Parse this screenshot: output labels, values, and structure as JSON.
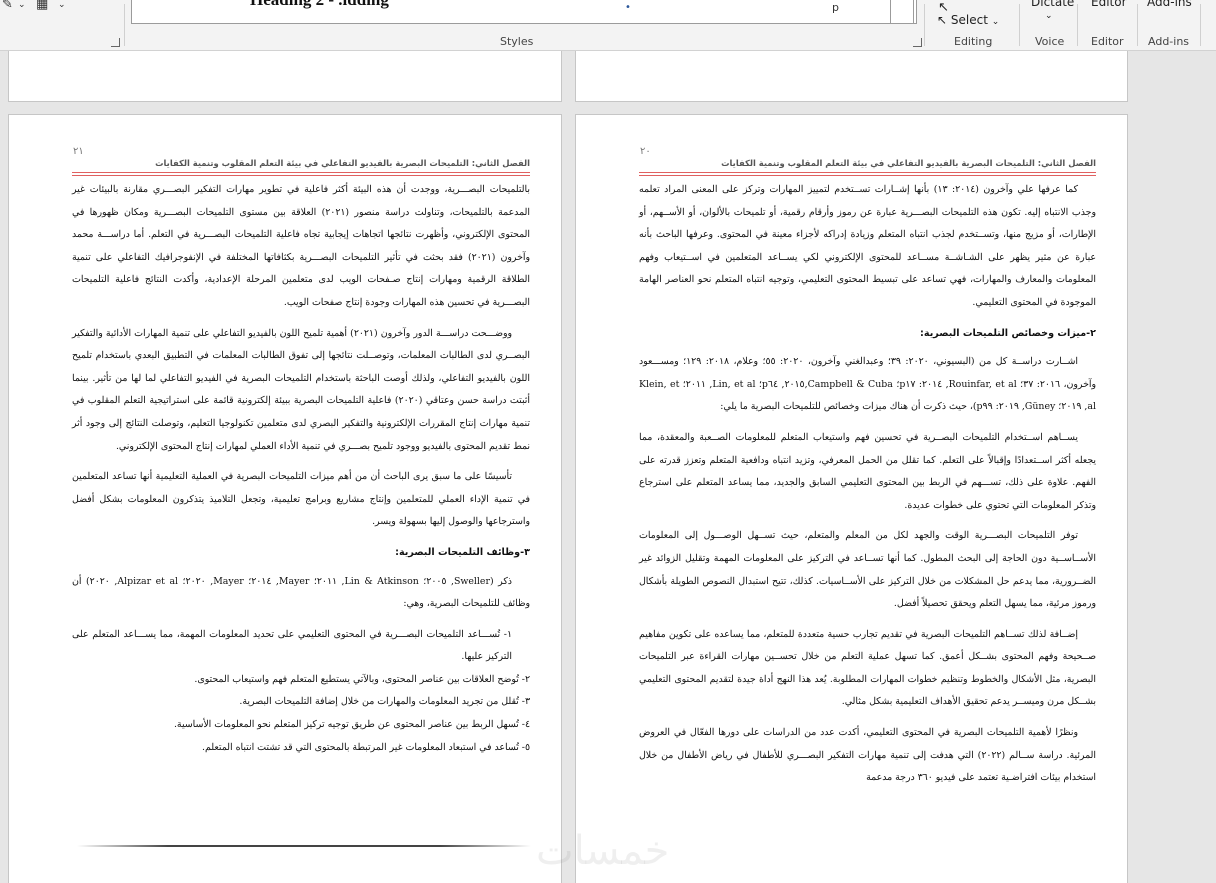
{
  "ribbon": {
    "groups": {
      "styles": "Styles",
      "editing": "Editing",
      "voice": "Voice",
      "editor": "Editor",
      "addins": "Add-ins"
    },
    "select_label": "Select",
    "dictate_label": "Dictate",
    "editor_btn": "Editor",
    "addins_btn": "Add-ins",
    "styles_preview": "Heading 2 - .idding",
    "styles_preview_p": "p"
  },
  "pages": {
    "left": {
      "number": "٢١",
      "running_head": "الفصل الثاني: التلميحات البصرية بالفيديو التفاعلي في بيئة التعلم المقلوب وتنمية الكفايات",
      "paragraphs": [
        "بالتلميحات البصـــرية، ووجدت أن هذه البيئة أكثر فاعلية في تطوير مهارات التفكير البصـــري مقارنة بالبيئات غير المدعمة بالتلميحات، وتناولت دراسة منصور (٢٠٢١) العلاقة بين مستوى التلميحات البصـــرية ومكان ظهورها في المحتوى الإلكتروني، وأظهرت نتائجها اتجاهات إيجابية تجاه فاعلية التلميحات البصـــرية في التعلم. أما دراســـة محمد وآخرون (٢٠٢١) فقد بحثت في تأثير التلميحات البصـــرية بكثافاتها المختلفة في الإنفوجرافيك التفاعلي على تنمية الطلاقة الرقمية ومهارات إنتاج صـفحات الويب لدى متعلمين المرحلة الإعدادية، وأكدت النتائج فاعلية التلميحات البصـــرية في تحسين هذه المهارات وجودة إنتاج صفحات الويب.",
        "ووضـــحت دراســـة الدور وآخرون (٢٠٢١) أهمية تلميح اللون بالفيديو التفاعلي على تنمية المهارات الأدائية والتفكير البصــري لدى الطالبات المعلمات، وتوصــلت نتائجها إلى تفوق الطالبات المعلمات في التطبيق البعدي باستخدام تلميح اللون بالفيديو التفاعلي، ولذلك أوصت الباحثة باستخدام التلميحات البصرية في الفيديو التفاعلي لما لها من تأثير. بينما أثبتت دراسة حسن وعتاقي (٢٠٢٠) فاعلية التلميحات البصرية ببيئة إلكترونية قائمة على استراتيجية التعلم المقلوب في تنمية مهارات إنتاج المقررات الإلكترونية والتفكير البصري لدى متعلمين تكنولوجيا التعليم، وتوصلت النتائج إلى وجود أثر نمط تقديم المحتوى بالفيديو ووجود تلميح بصـــري في تنمية الأداء العملي لمهارات إنتاج المحتوى الإلكتروني.",
        "تأسيسًا على ما سبق يرى الباحث أن من أهم ميزات التلميحات البصرية في العملية التعليمية أنها تساعد المتعلمين في تنمية الإداء العملي للمتعلمين وإنتاج مشاريع وبرامج تعليمية، وتجعل التلاميذ يتذكرون المعلومات بشكل أفضل واسترجاعها والوصول إليها بسهولة ويسر."
      ],
      "heading": "٣-وظائف التلميحات البصرية:",
      "intro": "ذكر (Sweller, ٢٠٠٥؛ Lin & Atkinson, ٢٠١١؛ Mayer, ٢٠١٤؛ Mayer, ٢٠٢٠؛ Alpizar et al, ٢٠٢٠) أن وظائف للتلميحات البصرية، وهي:",
      "list": [
        "١- تُســـاعد التلميحات البصـــرية في المحتوى التعليمي على تحديد المعلومات المهمة، مما يســـاعد المتعلم على التركيز عليها.",
        "٢- تُوضح العلاقات بين عناصر المحتوى، وبالآتي يستطيع المتعلم فهم واستيعاب المحتوى.",
        "٣- تُقلل من تجريد المعلومات والمهارات من خلال إضافة التلميحات البصرية.",
        "٤- تُسهل الربط بين عناصر المحتوى عن طريق توجيه تركيز المتعلم نحو المعلومات الأساسية.",
        "٥- تُساعد في استبعاد المعلومات غير المرتبطة بالمحتوى التي قد تشتت انتباه المتعلم."
      ]
    },
    "right": {
      "number": "٢٠",
      "running_head": "الفصل الثاني: التلميحات البصرية بالفيديو التفاعلي في بيئة التعلم المقلوب وتنمية الكفايات",
      "p1": "كما عرفها علي وآخرون (٢٠١٤: ١٣) بأنها إشــارات تســتخدم لتمييز المهارات وتركز على المعنى المراد تعلمه وجذب الانتباه إليه. تكون هذه التلميحات البصـــرية عبارة عن رموز وأرقام رقمية، أو تلميحات بالألوان، أو الأســهم، أو الإطارات، أو مزيج منها، وتســتخدم لجذب انتباه المتعلم وزيادة إدراكه لأجزاء معينة في المحتوى. وعرفها الباحث بأنه عبارة عن مثير يظهر على الشـاشــة مســاعد للمحتوى الإلكتروني لكي يســاعد المتعلمين في اســتيعاب وفهم المعلومات والمعارف والمهارات، فهي تساعد على تبسيط المحتوى التعليمي، وتوجيه انتباه المتعلم نحو العناصر الهامة الموجودة في المحتوى التعليمي.",
      "heading": "٢-ميزات وخصائص التلميحات البصرية:",
      "p2": "اشــارت دراســة كل من (البسيوني، ٢٠٢٠: ٣٩؛ وعبدالغني وآخرون، ٢٠٢٠: ٥٥؛ وعلام، ٢٠١٨: ١٢٩؛ ومســـعود وآخرون، ٢٠١٦: ٣٧؛ Rouinfar, et al, ٢٠١٤: p١٧؛ Campbell & Cuba,٢٠١٥, p٦٤؛ Lin, et al, ٢٠١١؛ Klein, et al, ٢٠١٩؛ Güney, ٢٠١٩: p٩٩)، حيث ذكرت أن هناك ميزات وخصائص للتلميحات البصرية ما يلي:",
      "p3": "يســاهم اســتخدام التلميحات البصــرية في تحسين فهم واستيعاب المتعلم للمعلومات الصــعبة والمعقدة، مما يجعله أكثر اســتعدادًا وإقبالاً على التعلم. كما تقلل من الحمل المعرفي، وتزيد انتباه ودافعية المتعلم وتعزز قدرته على الفهم. علاوة على ذلك، تســـهم في الربط بين المحتوى التعليمي السابق والجديد، مما يساعد المتعلم على استرجاع وتذكر المعلومات التي تحتوي على خطوات عديدة.",
      "p4": "توفر التلميحات البصـــرية الوقت والجهد لكل من المعلم والمتعلم، حيث تســهل الوصـــول إلى المعلومات الأســاســية دون الحاجة إلى البحث المطول. كما أنها تســاعد في التركيز على المعلومات المهمة وتقليل الزوائد غير الضــرورية، مما يدعم حل المشكلات من خلال التركيز على الأســاسيات. كذلك، تتيح استبدال النصوص الطويلة بأشكال ورموز مرئية، مما يسهل التعلم ويحقق تحصيلاً أفضل.",
      "p5": "إضــافة لذلك تســاهم التلميحات البصرية في تقديم تجارب حسية متعددة للمتعلم، مما يساعده على تكوين مفاهيم صــحيحة وفهم المحتوى بشــكل أعمق. كما تسهل عملية التعلم من خلال تحســين مهارات القراءة عبر التلميحات البصرية، مثل الأشكال والخطوط وتنظيم خطوات المهارات المطلوبة. يُعد هذا النهج أداة جيدة لتقديم المحتوى التعليمي بشــكل مرن وميســر يدعم تحقيق الأهداف التعليمية بشكل مثالي.",
      "p6": "ونظرًا لأهمية التلميحات البصرية في المحتوى التعليمي، أكدت عدد من الدراسات على دورها الفعّال في العروض المرئية. دراسة ســالم (٢٠٢٢) التي هدفت إلى تنمية مهارات التفكير البصـــري للأطفال في رياض الأطفال من خلال استخدام بيئات افتراضـية تعتمد على فيديو ٣٦٠ درجة مدعمة"
    }
  },
  "watermark": "خمسات"
}
